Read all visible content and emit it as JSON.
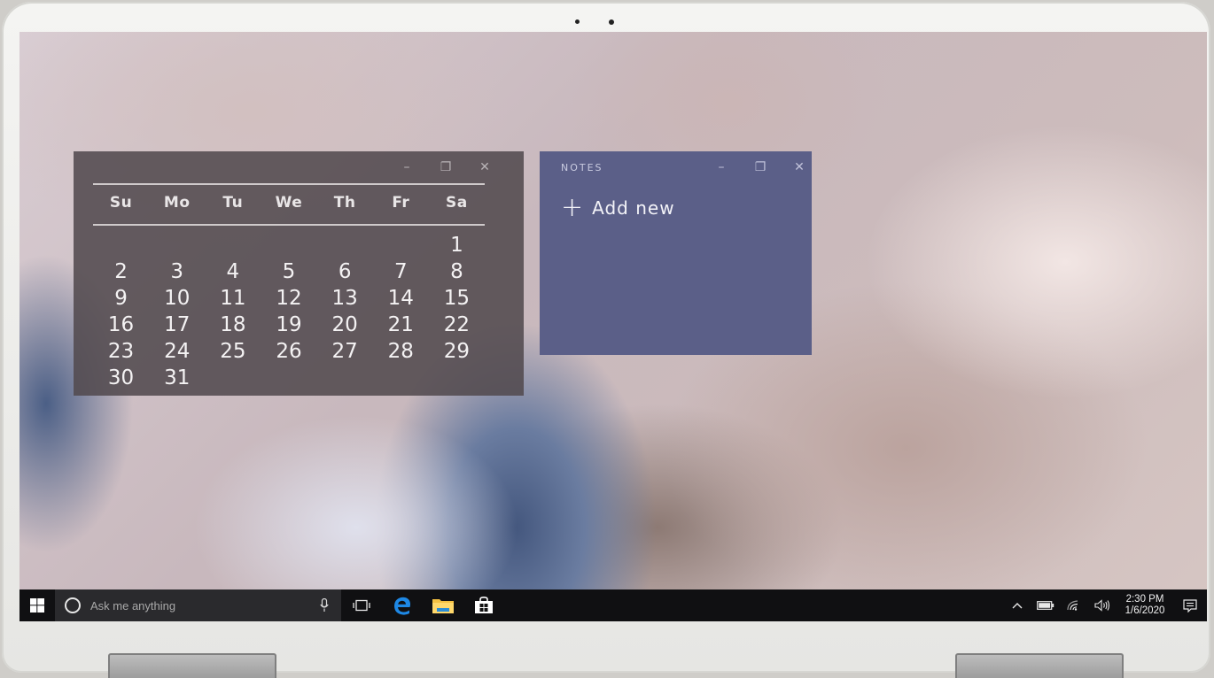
{
  "calendar": {
    "controls": {
      "minimize": "–",
      "restore": "❐",
      "close": "✕"
    },
    "weekdays": [
      "Su",
      "Mo",
      "Tu",
      "We",
      "Th",
      "Fr",
      "Sa"
    ],
    "days": [
      "",
      "",
      "",
      "",
      "",
      "",
      "1",
      "2",
      "3",
      "4",
      "5",
      "6",
      "7",
      "8",
      "9",
      "10",
      "11",
      "12",
      "13",
      "14",
      "15",
      "16",
      "17",
      "18",
      "19",
      "20",
      "21",
      "22",
      "23",
      "24",
      "25",
      "26",
      "27",
      "28",
      "29",
      "30",
      "31",
      "",
      "",
      "",
      "",
      ""
    ]
  },
  "notes": {
    "title": "NOTES",
    "controls": {
      "minimize": "–",
      "restore": "❐",
      "close": "✕"
    },
    "add_icon": "+",
    "add_label": "Add new"
  },
  "taskbar": {
    "search_placeholder": "Ask me anything",
    "apps": [
      "task-view-icon",
      "edge-icon",
      "file-explorer-icon",
      "store-icon"
    ],
    "tray_icons": [
      "chevron-up-icon",
      "battery-icon",
      "wifi-icon",
      "volume-icon",
      "action-center-icon"
    ],
    "time": "2:30 PM",
    "date": "1/6/2020"
  },
  "colors": {
    "taskbar": "#101012",
    "notes_bg": "#5b5f88",
    "calendar_bg": "#524a4e",
    "edge_blue": "#1e88e5",
    "folder_yellow": "#f5c142"
  }
}
